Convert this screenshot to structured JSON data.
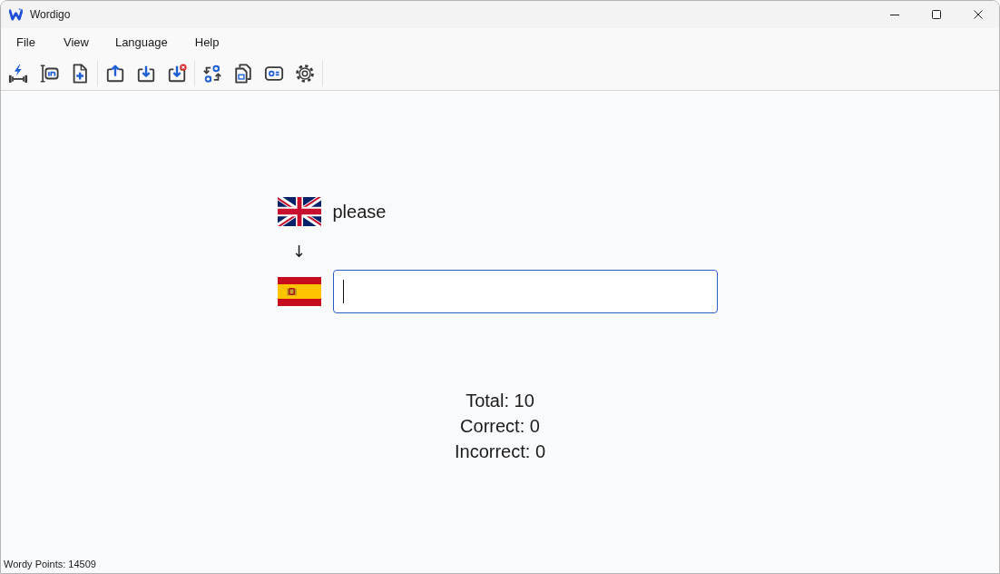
{
  "window": {
    "title": "Wordigo"
  },
  "menu": [
    {
      "label": "File"
    },
    {
      "label": "View"
    },
    {
      "label": "Language"
    },
    {
      "label": "Help"
    }
  ],
  "quiz": {
    "prompt": {
      "word": "please"
    },
    "arrow": "↓",
    "answer": {
      "focused": true
    }
  },
  "results": [
    "Total: 10",
    "Correct: 0",
    "Incorrect: 0"
  ],
  "status_bar": {
    "text": "Wordy Points: 14509"
  }
}
